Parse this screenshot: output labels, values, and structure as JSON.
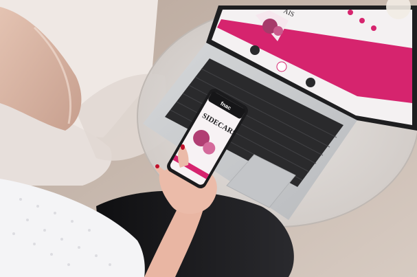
{
  "photo": {
    "phone_brand": "fnac",
    "phone_headline": "SIDECARS",
    "laptop_headline": "AIS",
    "colors": {
      "magenta": "#d6246e",
      "pink_light": "#f1a9c8",
      "chair": "#ebe3df",
      "floor": "#c9b9ae",
      "table_glass": "#dad6d3",
      "laptop_silver": "#c9cbce",
      "keys": "#2a2a2c",
      "phone_body": "#1b1b1d",
      "pants": "#1a1a1c",
      "skin": "#e9b6a3",
      "nails": "#c0102a"
    }
  }
}
